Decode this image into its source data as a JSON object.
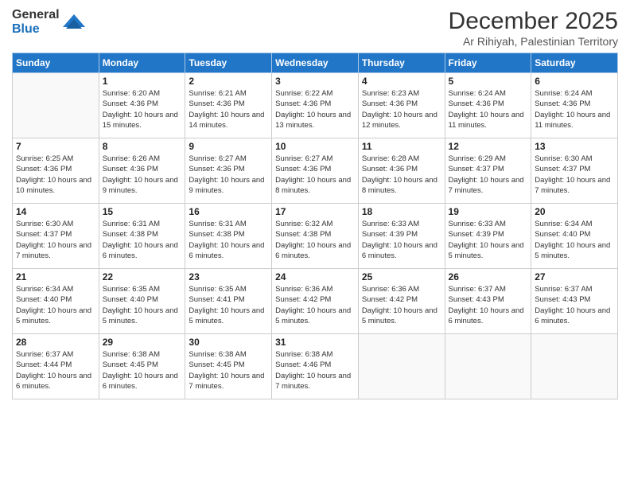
{
  "logo": {
    "general": "General",
    "blue": "Blue"
  },
  "title": "December 2025",
  "location": "Ar Rihiyah, Palestinian Territory",
  "weekdays": [
    "Sunday",
    "Monday",
    "Tuesday",
    "Wednesday",
    "Thursday",
    "Friday",
    "Saturday"
  ],
  "weeks": [
    [
      {
        "day": "",
        "info": ""
      },
      {
        "day": "1",
        "info": "Sunrise: 6:20 AM\nSunset: 4:36 PM\nDaylight: 10 hours\nand 15 minutes."
      },
      {
        "day": "2",
        "info": "Sunrise: 6:21 AM\nSunset: 4:36 PM\nDaylight: 10 hours\nand 14 minutes."
      },
      {
        "day": "3",
        "info": "Sunrise: 6:22 AM\nSunset: 4:36 PM\nDaylight: 10 hours\nand 13 minutes."
      },
      {
        "day": "4",
        "info": "Sunrise: 6:23 AM\nSunset: 4:36 PM\nDaylight: 10 hours\nand 12 minutes."
      },
      {
        "day": "5",
        "info": "Sunrise: 6:24 AM\nSunset: 4:36 PM\nDaylight: 10 hours\nand 11 minutes."
      },
      {
        "day": "6",
        "info": "Sunrise: 6:24 AM\nSunset: 4:36 PM\nDaylight: 10 hours\nand 11 minutes."
      }
    ],
    [
      {
        "day": "7",
        "info": "Sunrise: 6:25 AM\nSunset: 4:36 PM\nDaylight: 10 hours\nand 10 minutes."
      },
      {
        "day": "8",
        "info": "Sunrise: 6:26 AM\nSunset: 4:36 PM\nDaylight: 10 hours\nand 9 minutes."
      },
      {
        "day": "9",
        "info": "Sunrise: 6:27 AM\nSunset: 4:36 PM\nDaylight: 10 hours\nand 9 minutes."
      },
      {
        "day": "10",
        "info": "Sunrise: 6:27 AM\nSunset: 4:36 PM\nDaylight: 10 hours\nand 8 minutes."
      },
      {
        "day": "11",
        "info": "Sunrise: 6:28 AM\nSunset: 4:36 PM\nDaylight: 10 hours\nand 8 minutes."
      },
      {
        "day": "12",
        "info": "Sunrise: 6:29 AM\nSunset: 4:37 PM\nDaylight: 10 hours\nand 7 minutes."
      },
      {
        "day": "13",
        "info": "Sunrise: 6:30 AM\nSunset: 4:37 PM\nDaylight: 10 hours\nand 7 minutes."
      }
    ],
    [
      {
        "day": "14",
        "info": "Sunrise: 6:30 AM\nSunset: 4:37 PM\nDaylight: 10 hours\nand 7 minutes."
      },
      {
        "day": "15",
        "info": "Sunrise: 6:31 AM\nSunset: 4:38 PM\nDaylight: 10 hours\nand 6 minutes."
      },
      {
        "day": "16",
        "info": "Sunrise: 6:31 AM\nSunset: 4:38 PM\nDaylight: 10 hours\nand 6 minutes."
      },
      {
        "day": "17",
        "info": "Sunrise: 6:32 AM\nSunset: 4:38 PM\nDaylight: 10 hours\nand 6 minutes."
      },
      {
        "day": "18",
        "info": "Sunrise: 6:33 AM\nSunset: 4:39 PM\nDaylight: 10 hours\nand 6 minutes."
      },
      {
        "day": "19",
        "info": "Sunrise: 6:33 AM\nSunset: 4:39 PM\nDaylight: 10 hours\nand 5 minutes."
      },
      {
        "day": "20",
        "info": "Sunrise: 6:34 AM\nSunset: 4:40 PM\nDaylight: 10 hours\nand 5 minutes."
      }
    ],
    [
      {
        "day": "21",
        "info": "Sunrise: 6:34 AM\nSunset: 4:40 PM\nDaylight: 10 hours\nand 5 minutes."
      },
      {
        "day": "22",
        "info": "Sunrise: 6:35 AM\nSunset: 4:40 PM\nDaylight: 10 hours\nand 5 minutes."
      },
      {
        "day": "23",
        "info": "Sunrise: 6:35 AM\nSunset: 4:41 PM\nDaylight: 10 hours\nand 5 minutes."
      },
      {
        "day": "24",
        "info": "Sunrise: 6:36 AM\nSunset: 4:42 PM\nDaylight: 10 hours\nand 5 minutes."
      },
      {
        "day": "25",
        "info": "Sunrise: 6:36 AM\nSunset: 4:42 PM\nDaylight: 10 hours\nand 5 minutes."
      },
      {
        "day": "26",
        "info": "Sunrise: 6:37 AM\nSunset: 4:43 PM\nDaylight: 10 hours\nand 6 minutes."
      },
      {
        "day": "27",
        "info": "Sunrise: 6:37 AM\nSunset: 4:43 PM\nDaylight: 10 hours\nand 6 minutes."
      }
    ],
    [
      {
        "day": "28",
        "info": "Sunrise: 6:37 AM\nSunset: 4:44 PM\nDaylight: 10 hours\nand 6 minutes."
      },
      {
        "day": "29",
        "info": "Sunrise: 6:38 AM\nSunset: 4:45 PM\nDaylight: 10 hours\nand 6 minutes."
      },
      {
        "day": "30",
        "info": "Sunrise: 6:38 AM\nSunset: 4:45 PM\nDaylight: 10 hours\nand 7 minutes."
      },
      {
        "day": "31",
        "info": "Sunrise: 6:38 AM\nSunset: 4:46 PM\nDaylight: 10 hours\nand 7 minutes."
      },
      {
        "day": "",
        "info": ""
      },
      {
        "day": "",
        "info": ""
      },
      {
        "day": "",
        "info": ""
      }
    ]
  ]
}
